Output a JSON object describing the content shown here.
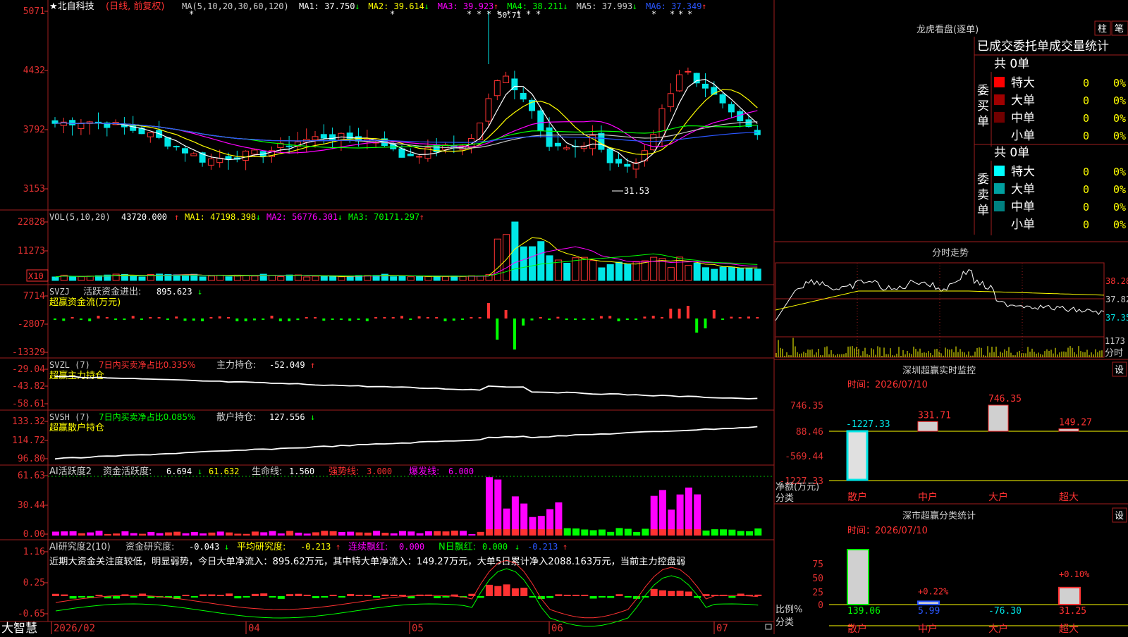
{
  "colors": {
    "up": "#ff3232",
    "down": "#00e6e6",
    "green": "#00ff00",
    "yellow": "#ffff00",
    "magenta": "#ff00ff",
    "white": "#ffffff",
    "red_frame": "#a01e1e",
    "blue": "#2a56ff",
    "axis_text": "#e03030",
    "text": "#d0d0d0"
  },
  "stock": {
    "name": "★北自科技",
    "mode": "(日线, 前复权)",
    "ma_prefix": "MA(5,10,20,30,60,120)",
    "ma_values": [
      {
        "label": "MA1:",
        "value": "37.750",
        "arrow": "↓",
        "color": "#ffffff"
      },
      {
        "label": "MA2:",
        "value": "39.614",
        "arrow": "↓",
        "color": "#ffff00"
      },
      {
        "label": "MA3:",
        "value": "39.923",
        "arrow": "↑",
        "color": "#ff00ff"
      },
      {
        "label": "MA4:",
        "value": "38.211",
        "arrow": "↓",
        "color": "#00ff00"
      },
      {
        "label": "MA5:",
        "value": "37.993",
        "arrow": "↓",
        "color": "#d0d0d0"
      },
      {
        "label": "MA6:",
        "value": "37.349",
        "arrow": "↑",
        "color": "#2a56ff"
      }
    ],
    "price_axis": [
      "5071",
      "4432",
      "3792",
      "3153"
    ],
    "high_label": "50.71",
    "low_label": "31.53"
  },
  "volume": {
    "header": "VOL(5,10,20)",
    "value": "43720.000",
    "value_arrow": "↑",
    "mas": [
      {
        "label": "MA1:",
        "value": "47198.398",
        "arrow": "↓",
        "color": "#ffff00"
      },
      {
        "label": "MA2:",
        "value": "56776.301",
        "arrow": "↓",
        "color": "#ff00ff"
      },
      {
        "label": "MA3:",
        "value": "70171.297",
        "arrow": "↑",
        "color": "#00ff00"
      }
    ],
    "axis": [
      "22828",
      "11273"
    ],
    "unit": "X10"
  },
  "svzj": {
    "header": "SVZJ",
    "label": "活跃资金进出:",
    "value": "895.623",
    "arrow": "↓",
    "subtitle": "超赢资金流(万元)",
    "axis": [
      "7714",
      "-2807",
      "-13329"
    ]
  },
  "svzl": {
    "header": "SVZL (7)",
    "label": "7日内买卖净占比0.335%",
    "label2": "主力持仓:",
    "value": "-52.049",
    "arrow": "↑",
    "subtitle": "超赢主力持仓",
    "axis": [
      "-29.04",
      "-43.82",
      "-58.61"
    ]
  },
  "svsh": {
    "header": "SVSH (7)",
    "label": "7日内买卖净占比0.085%",
    "label2": "散户持仓:",
    "value": "127.556",
    "arrow": "↓",
    "subtitle": "超赢散户持仓",
    "axis": [
      "133.32",
      "114.72",
      "96.80"
    ]
  },
  "ai_active": {
    "header": "AI活跃度2",
    "l1": "资金活跃度:",
    "v1": "6.694",
    "a1": "↓",
    "v2": "61.632",
    "l3": "生命线:",
    "v3": "1.560",
    "l4": "强势线:",
    "v4": "3.000",
    "l5": "爆发线:",
    "v5": "6.000",
    "axis": [
      "61.63",
      "30.44",
      "0.00"
    ]
  },
  "ai_research": {
    "header": "AI研究度2(10)",
    "l1": "资金研究度:",
    "v1": "-0.043",
    "a1": "↓",
    "l2": "平均研究度:",
    "v2": "-0.213",
    "a2": "↑",
    "l3": "连续飘红:",
    "v3": "0.000",
    "l4": "N日飘红:",
    "v4": "0.000",
    "a4": "↓",
    "v5": "-0.213",
    "a5": "↑",
    "comment": "近期大资金关注度较低，明显弱势，今日大单净流入：895.62万元，其中特大单净流入：149.27万元，大单5日累计净入2088.163万元，当前主力控盘弱",
    "axis": [
      "1.16",
      "0.25",
      "-0.65"
    ]
  },
  "date_axis": [
    "2026/02",
    "04",
    "05",
    "06",
    "07"
  ],
  "logo": "大智慧",
  "right": {
    "dragon_title": "龙虎看盘(逐单)",
    "tab_col": "柱",
    "tab_pen": "笔",
    "stats_header": "已成交委托单成交量统计",
    "buy_group": {
      "label": "委买单",
      "total": "共 0单",
      "rows": [
        {
          "name": "特大",
          "count": "0",
          "pct": "0%",
          "color": "#ff0000"
        },
        {
          "name": "大单",
          "count": "0",
          "pct": "0%",
          "color": "#a00000"
        },
        {
          "name": "中单",
          "count": "0",
          "pct": "0%",
          "color": "#700000"
        },
        {
          "name": "小单",
          "count": "0",
          "pct": "0%",
          "color": "#000000"
        }
      ]
    },
    "sell_group": {
      "label": "委卖单",
      "total": "共 0单",
      "rows": [
        {
          "name": "特大",
          "count": "0",
          "pct": "0%",
          "color": "#00ffff"
        },
        {
          "name": "大单",
          "count": "0",
          "pct": "0%",
          "color": "#00a0a0"
        },
        {
          "name": "中单",
          "count": "0",
          "pct": "0%",
          "color": "#008080"
        },
        {
          "name": "小单",
          "count": "0",
          "pct": "0%",
          "color": "#000000"
        }
      ]
    },
    "intraday_title": "分时走势",
    "intraday_axis": [
      "38.28",
      "37.82",
      "37.35"
    ],
    "intraday_vol": "1173",
    "intraday_vol_label": "分时",
    "sz_monitor": {
      "title": "深圳超赢实时监控",
      "settings": "设",
      "time_label": "时间：2026/07/10",
      "axis": [
        "746.35",
        "88.46",
        "-569.44",
        "-1227.33"
      ],
      "ylabel1": "净额(万元)",
      "ylabel2": "分类",
      "categories": [
        "散户",
        "中户",
        "大户",
        "超大"
      ],
      "values": [
        -1227.33,
        331.71,
        746.35,
        149.27
      ],
      "value_labels": [
        "-1227.33",
        "331.71",
        "746.35",
        "149.27"
      ]
    },
    "sz_class": {
      "title": "深市超赢分类统计",
      "settings": "设",
      "time_label": "时间：2026/07/10",
      "axis": [
        "75",
        "50",
        "25",
        "0"
      ],
      "ylabel1": "比例%",
      "ylabel2": "分类",
      "categories": [
        "散户",
        "中户",
        "大户",
        "超大"
      ],
      "values": [
        139.06,
        5.99,
        -76.3,
        31.25
      ],
      "value_labels": [
        "139.06",
        "5.99",
        "-76.30",
        "31.25"
      ],
      "pct_labels": [
        "",
        "+0.22%",
        "",
        "+0.10%"
      ]
    }
  },
  "chart_data": [
    {
      "type": "candlestick",
      "title": "北自科技 日线",
      "x": [
        "2026/02",
        "04",
        "05",
        "06",
        "07"
      ],
      "ylim": [
        31.53,
        50.71
      ],
      "ma_lines": [
        "MA1",
        "MA2",
        "MA3",
        "MA4",
        "MA5",
        "MA6"
      ],
      "high": 50.71,
      "low": 31.53
    },
    {
      "type": "bar",
      "title": "VOL(5,10,20)",
      "y_ticks": [
        22828,
        11273
      ],
      "latest": 43720.0
    },
    {
      "type": "bar",
      "title": "深圳超赢实时监控",
      "categories": [
        "散户",
        "中户",
        "大户",
        "超大"
      ],
      "values": [
        -1227.33,
        331.71,
        746.35,
        149.27
      ],
      "ylabel": "净额(万元)",
      "ylim": [
        -1227.33,
        746.35
      ]
    },
    {
      "type": "bar",
      "title": "深市超赢分类统计",
      "categories": [
        "散户",
        "中户",
        "大户",
        "超大"
      ],
      "values": [
        139.06,
        5.99,
        -76.3,
        31.25
      ],
      "ylabel": "比例%",
      "ylim": [
        0,
        75
      ]
    }
  ]
}
